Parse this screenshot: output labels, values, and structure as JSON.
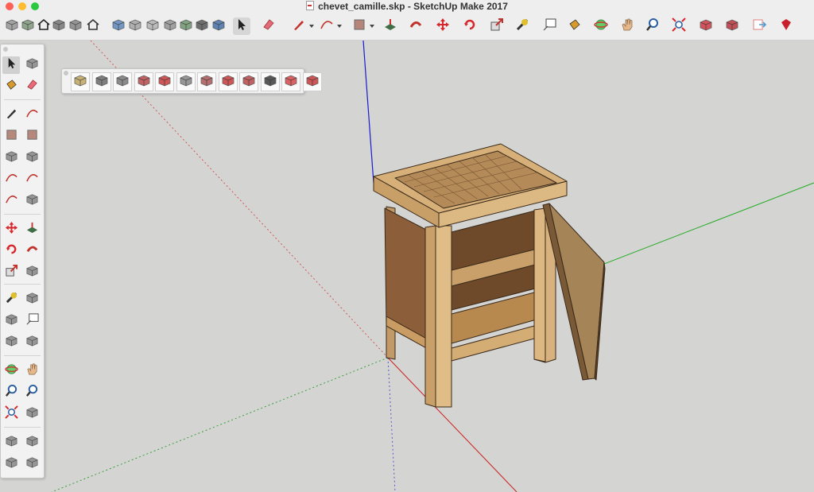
{
  "window": {
    "title": "chevet_camille.skp - SketchUp Make 2017",
    "traffic_lights": [
      "#fe5f57",
      "#febc2e",
      "#28c840"
    ]
  },
  "toolbar": {
    "items": [
      {
        "name": "warehouse-icon",
        "icon": "box",
        "color": "#8a8a8a"
      },
      {
        "name": "components-icon",
        "icon": "box",
        "color": "#6e8c6a"
      },
      {
        "name": "home-view-icon",
        "icon": "house",
        "color": "#222222"
      },
      {
        "name": "iso-view-icon",
        "icon": "box",
        "color": "#666666"
      },
      {
        "name": "front-view-icon",
        "icon": "box",
        "color": "#777777"
      },
      {
        "name": "top-house-icon",
        "icon": "house",
        "color": "#333333"
      },
      {
        "name": "xray-icon",
        "icon": "box",
        "color": "#4a7ab8"
      },
      {
        "name": "back-edges-icon",
        "icon": "box",
        "color": "#9a9a9a"
      },
      {
        "name": "wireframe-icon",
        "icon": "box",
        "color": "#aaaaaa"
      },
      {
        "name": "hidden-line-icon",
        "icon": "box",
        "color": "#888888"
      },
      {
        "name": "shaded-icon",
        "icon": "box",
        "color": "#5f8a5f"
      },
      {
        "name": "shaded-textures-icon",
        "icon": "box",
        "color": "#444444"
      },
      {
        "name": "monochrome-icon",
        "icon": "box",
        "color": "#2e5f9e"
      },
      {
        "name": "select-tool-icon",
        "icon": "arrow",
        "color": "#222222",
        "selected": true
      },
      {
        "name": "eraser-icon",
        "icon": "eraser",
        "color": "#e56b7a"
      },
      {
        "name": "pencil-icon",
        "icon": "pencil",
        "color": "#c0322b",
        "dropdown": true
      },
      {
        "name": "arc-icon",
        "icon": "arc",
        "color": "#c0322b",
        "dropdown": true
      },
      {
        "name": "rectangle-icon",
        "icon": "rect",
        "color": "#9e5a4a",
        "dropdown": true
      },
      {
        "name": "push-pull-icon",
        "icon": "pushpull",
        "color": "#3f6e46"
      },
      {
        "name": "follow-me-icon",
        "icon": "follow",
        "color": "#c0322b"
      },
      {
        "name": "move-icon",
        "icon": "move",
        "color": "#d8262a"
      },
      {
        "name": "rotate-icon",
        "icon": "rotate",
        "color": "#d8262a"
      },
      {
        "name": "scale-icon",
        "icon": "scale",
        "color": "#c0322b"
      },
      {
        "name": "tape-measure-icon",
        "icon": "tape",
        "color": "#e0c030"
      },
      {
        "name": "text-tool-icon",
        "icon": "text",
        "color": "#444444"
      },
      {
        "name": "paint-bucket-icon",
        "icon": "bucket",
        "color": "#d89a2a"
      },
      {
        "name": "orbit-icon",
        "icon": "orbit",
        "color": "#3c8a4c"
      },
      {
        "name": "pan-icon",
        "icon": "hand",
        "color": "#e4b88a"
      },
      {
        "name": "zoom-icon",
        "icon": "zoom",
        "color": "#2a5ea0"
      },
      {
        "name": "zoom-extents-icon",
        "icon": "extents",
        "color": "#d8262a"
      },
      {
        "name": "3d-warehouse-icon",
        "icon": "box",
        "color": "#c8202a"
      },
      {
        "name": "extension-warehouse-icon",
        "icon": "box",
        "color": "#b01c24"
      },
      {
        "name": "send-to-layout-icon",
        "icon": "layout",
        "color": "#e08080"
      },
      {
        "name": "extension-manager-icon",
        "icon": "ruby",
        "color": "#c8202a"
      }
    ]
  },
  "sidebar": {
    "rows": [
      [
        "select-icon",
        "component-icon"
      ],
      [
        "paint-bucket-icon",
        "eraser-icon"
      ],
      [
        "pencil-icon",
        "freehand-icon"
      ],
      [
        "rectangle-icon",
        "rotated-rectangle-icon"
      ],
      [
        "circle-icon",
        "polygon-icon"
      ],
      [
        "arc-icon",
        "2pt-arc-icon"
      ],
      [
        "3pt-arc-icon",
        "pie-icon"
      ],
      [
        "move-icon",
        "push-pull-icon"
      ],
      [
        "rotate-icon",
        "follow-me-icon"
      ],
      [
        "scale-icon",
        "offset-icon"
      ],
      [
        "tape-measure-icon",
        "dimension-icon"
      ],
      [
        "protractor-icon",
        "text-icon"
      ],
      [
        "axes-icon",
        "3d-text-icon"
      ],
      [
        "orbit-icon",
        "pan-icon"
      ],
      [
        "zoom-icon",
        "zoom-window-icon"
      ],
      [
        "zoom-extents-icon",
        "previous-view-icon"
      ],
      [
        "position-camera-icon",
        "walk-icon"
      ],
      [
        "look-around-icon",
        "section-plane-icon"
      ]
    ]
  },
  "float_toolbar": {
    "items": [
      "bill-of-materials-icon",
      "dimension-tool-icon",
      "list-report-icon",
      "joint-icon",
      "tenon-icon",
      "profile-icon",
      "dado-icon",
      "chamfer-icon",
      "round-edge-icon",
      "groove-icon",
      "cut-list-icon",
      "layout-icon"
    ]
  }
}
